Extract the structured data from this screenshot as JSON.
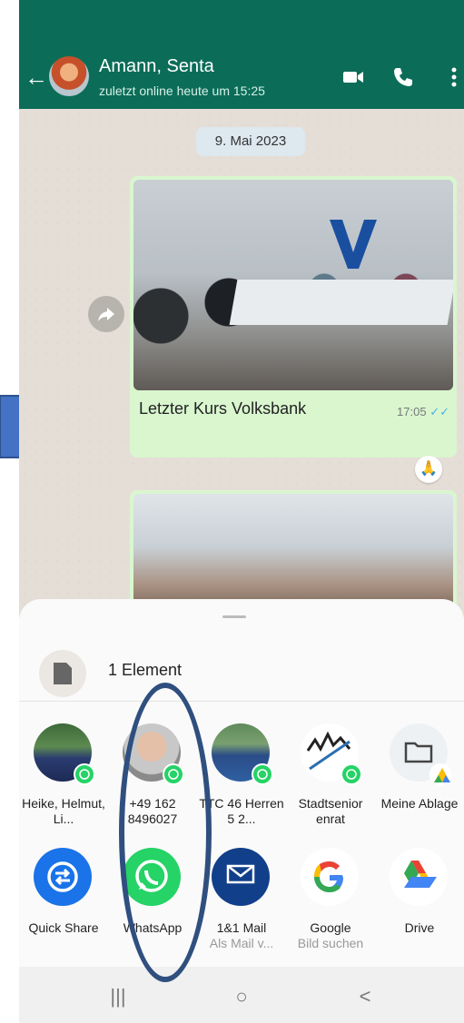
{
  "header": {
    "contact_name": "Amann, Senta",
    "status": "zuletzt online heute um 15:25"
  },
  "chat": {
    "date_chip": "9. Mai 2023",
    "message": {
      "caption": "Letzter Kurs Volksbank",
      "time": "17:05",
      "ticks": "✓✓",
      "reaction": "🙏"
    }
  },
  "share_sheet": {
    "element_count_label": "1 Element",
    "contacts": [
      {
        "label": "Heike, Helmut, Li..."
      },
      {
        "label": "+49 162 8496027"
      },
      {
        "label": "TTC 46 Herren 5 2..."
      },
      {
        "label": "Stadtsenior enrat"
      },
      {
        "label": "Meine Ablage"
      }
    ],
    "apps": [
      {
        "label": "Quick Share",
        "sub": ""
      },
      {
        "label": "WhatsApp",
        "sub": ""
      },
      {
        "label": "1&1 Mail",
        "sub": "Als Mail v..."
      },
      {
        "label": "Google",
        "sub": "Bild suchen"
      },
      {
        "label": "Drive",
        "sub": ""
      }
    ]
  },
  "navbar": {
    "recent": "|||",
    "home": "○",
    "back": "<"
  },
  "colors": {
    "whatsapp_header": "#0b6d58",
    "whatsapp_green": "#25d366",
    "annotation_blue": "#4472c4",
    "annotation_ellipse": "#2f4f7f"
  }
}
